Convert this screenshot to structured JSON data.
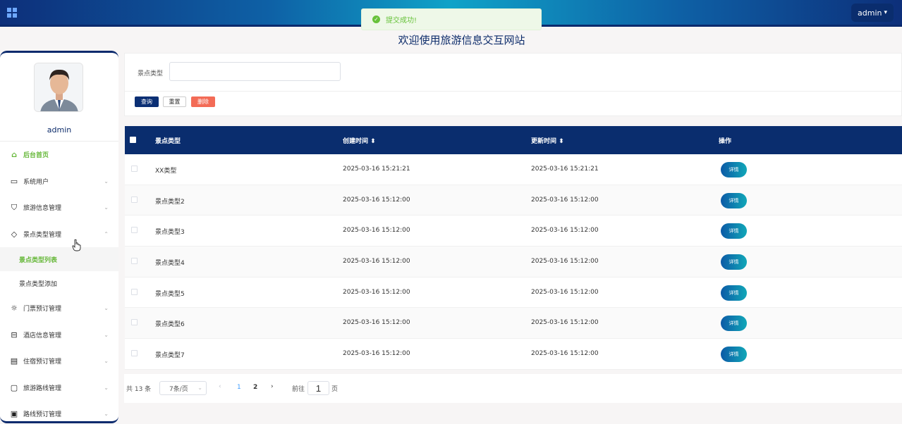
{
  "header": {
    "user_menu_label": "admin",
    "toast_text": "提交成功!",
    "site_title": "欢迎使用旅游信息交互网站"
  },
  "sidebar": {
    "username": "admin",
    "items": [
      {
        "label": "后台首页",
        "icon": "home-icon"
      },
      {
        "label": "系统用户",
        "icon": "monitor-icon"
      },
      {
        "label": "旅游信息管理",
        "icon": "bookmark-icon"
      },
      {
        "label": "景点类型管理",
        "icon": "tag-icon"
      },
      {
        "label": "门票预订管理",
        "icon": "sun-icon"
      },
      {
        "label": "酒店信息管理",
        "icon": "inbox-icon"
      },
      {
        "label": "住宿预订管理",
        "icon": "clipboard-icon"
      },
      {
        "label": "旅游路线管理",
        "icon": "chat-icon"
      },
      {
        "label": "路线预订管理",
        "icon": "archive-icon"
      }
    ],
    "subitems": [
      {
        "label": "景点类型列表"
      },
      {
        "label": "景点类型添加"
      }
    ]
  },
  "filter": {
    "label": "景点类型",
    "input_value": "",
    "buttons": {
      "search": "查询",
      "reset": "重置",
      "delete": "删除"
    }
  },
  "table": {
    "headers": [
      "景点类型",
      "创建时间 ⬍",
      "更新时间 ⬍",
      "操作"
    ],
    "action_label": "详情",
    "rows": [
      {
        "type": "XX类型",
        "created": "2025-03-16 15:21:21",
        "updated": "2025-03-16 15:21:21"
      },
      {
        "type": "景点类型2",
        "created": "2025-03-16 15:12:00",
        "updated": "2025-03-16 15:12:00"
      },
      {
        "type": "景点类型3",
        "created": "2025-03-16 15:12:00",
        "updated": "2025-03-16 15:12:00"
      },
      {
        "type": "景点类型4",
        "created": "2025-03-16 15:12:00",
        "updated": "2025-03-16 15:12:00"
      },
      {
        "type": "景点类型5",
        "created": "2025-03-16 15:12:00",
        "updated": "2025-03-16 15:12:00"
      },
      {
        "type": "景点类型6",
        "created": "2025-03-16 15:12:00",
        "updated": "2025-03-16 15:12:00"
      },
      {
        "type": "景点类型7",
        "created": "2025-03-16 15:12:00",
        "updated": "2025-03-16 15:12:00"
      }
    ]
  },
  "pagination": {
    "total": "共 13 条",
    "page_size": "7条/页",
    "pages": [
      "1",
      "2"
    ],
    "goto_label": "前往",
    "goto_value": "1",
    "page_suffix": "页"
  }
}
